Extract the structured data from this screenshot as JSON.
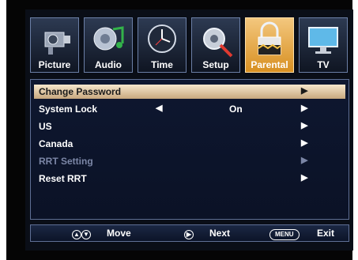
{
  "tabs": [
    {
      "label": "Picture",
      "icon": "camcorder-icon"
    },
    {
      "label": "Audio",
      "icon": "music-note-icon"
    },
    {
      "label": "Time",
      "icon": "clock-icon"
    },
    {
      "label": "Setup",
      "icon": "gear-wrench-icon"
    },
    {
      "label": "Parental",
      "icon": "padlock-icon"
    },
    {
      "label": "TV",
      "icon": "tv-icon"
    }
  ],
  "menu": {
    "items": [
      {
        "label": "Change Password"
      },
      {
        "label": "System Lock",
        "value": "On"
      },
      {
        "label": "US"
      },
      {
        "label": "Canada"
      },
      {
        "label": "RRT Setting"
      },
      {
        "label": "Reset RRT"
      }
    ]
  },
  "footer": {
    "move_label": "Move",
    "next_label": "Next",
    "menu_badge": "MENU",
    "exit_label": "Exit"
  },
  "colors": {
    "active_tab": "#e3a43d",
    "selected_row": "#e6cfac",
    "panel_bg": "#0e1730"
  }
}
